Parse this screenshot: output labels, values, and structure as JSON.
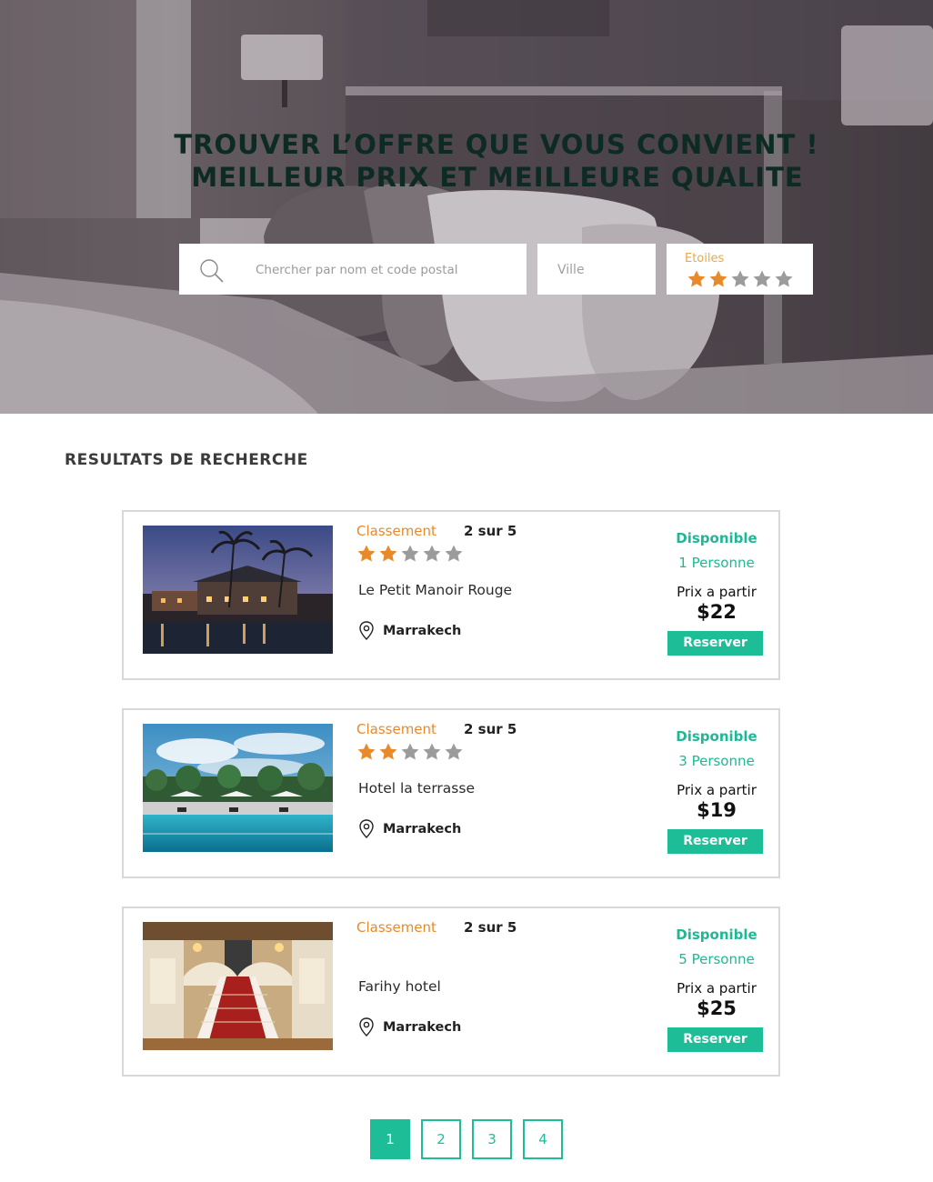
{
  "hero": {
    "title_line1": "TROUVER L’OFFRE QUE VOUS CONVIENT !",
    "title_line2": "MEILLEUR PRIX ET MEILLEURE QUALITE",
    "search_placeholder": "Chercher par nom et code postal",
    "city_placeholder": "Ville",
    "stars_label": "Etoiles",
    "stars_selected": 2,
    "stars_total": 5
  },
  "results": {
    "title": "RESULTATS DE RECHERCHE",
    "cards": [
      {
        "rank_label": "Classement",
        "rank_value": "2 sur 5",
        "stars_filled": 2,
        "name": "Le Petit Manoir Rouge",
        "city": "Marrakech",
        "availability": "Disponible",
        "persons": "1 Personne",
        "price_from": "Prix a partir",
        "price": "$22",
        "reserve_label": "Reserver",
        "photo": "night-resort-palms"
      },
      {
        "rank_label": "Classement",
        "rank_value": "2 sur 5",
        "stars_filled": 2,
        "name": "Hotel la terrasse",
        "city": "Marrakech",
        "availability": "Disponible",
        "persons": "3 Personne",
        "price_from": "Prix a partir",
        "price": "$19",
        "reserve_label": "Reserver",
        "photo": "pool-with-umbrellas"
      },
      {
        "rank_label": "Classement",
        "rank_value": "2 sur 5",
        "stars_filled": 0,
        "name": "Farihy hotel",
        "city": "Marrakech",
        "availability": "Disponible",
        "persons": "5 Personne",
        "price_from": "Prix a partir",
        "price": "$25",
        "reserve_label": "Reserver",
        "photo": "grand-staircase-lobby"
      }
    ]
  },
  "pagination": {
    "pages": [
      "1",
      "2",
      "3",
      "4"
    ],
    "active": "1"
  },
  "colors": {
    "accent": "#1dbd97",
    "star_on": "#e8892a",
    "star_off": "#9b9b9b",
    "rank": "#e8892a",
    "title": "#0d2b22"
  },
  "icons": {
    "search": "search-icon",
    "pin": "map-pin-icon",
    "star": "star-icon"
  }
}
